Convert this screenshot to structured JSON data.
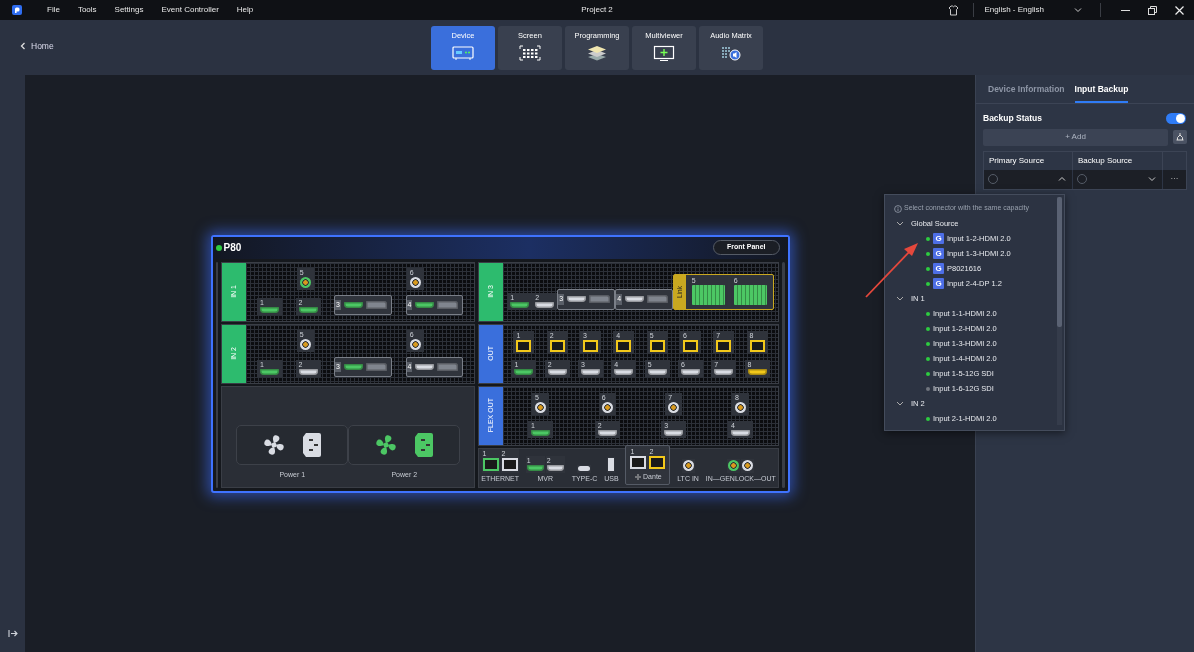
{
  "menu": [
    "File",
    "Tools",
    "Settings",
    "Event Controller",
    "Help"
  ],
  "window": {
    "title": "Project 2"
  },
  "language": {
    "value": "English - English"
  },
  "nav": {
    "back": "Home",
    "tabs": [
      {
        "label": "Device",
        "selected": true
      },
      {
        "label": "Screen",
        "selected": false
      },
      {
        "label": "Programming",
        "selected": false
      },
      {
        "label": "Multiviewer",
        "selected": false
      },
      {
        "label": "Audio Matrix",
        "selected": false
      }
    ]
  },
  "device": {
    "name": "P80",
    "online": true,
    "front_panel_button": "Front Panel",
    "left_slots": [
      {
        "label": "IN 1",
        "kind": "input",
        "top": [
          {
            "kind": "bnc",
            "number": "5",
            "color": "#4cc764"
          },
          {
            "kind": "bnc",
            "number": "6",
            "color": "#d9dce3"
          }
        ],
        "bottom": [
          {
            "kind": "hdmi",
            "number": "1",
            "color": "#4cc764"
          },
          {
            "kind": "hdmi",
            "number": "2",
            "color": "#4cc764"
          },
          {
            "kind": "module",
            "number": "3",
            "ports": [
              {
                "kind": "hdmi",
                "color": "#4cc764"
              },
              {
                "kind": "dp",
                "color": "#80858e"
              }
            ]
          },
          {
            "kind": "module",
            "number": "4",
            "ports": [
              {
                "kind": "hdmi",
                "color": "#4cc764"
              },
              {
                "kind": "dp",
                "color": "#80858e"
              }
            ]
          }
        ]
      },
      {
        "label": "IN 2",
        "kind": "input",
        "top": [
          {
            "kind": "bnc",
            "number": "5",
            "color": "#d9dce3"
          },
          {
            "kind": "bnc",
            "number": "6",
            "color": "#d9dce3"
          }
        ],
        "bottom": [
          {
            "kind": "hdmi",
            "number": "1",
            "color": "#4cc764"
          },
          {
            "kind": "hdmi",
            "number": "2",
            "color": "#d9dce3"
          },
          {
            "kind": "module",
            "number": "3",
            "ports": [
              {
                "kind": "hdmi",
                "color": "#4cc764"
              },
              {
                "kind": "dp",
                "color": "#80858e"
              }
            ]
          },
          {
            "kind": "module",
            "number": "4",
            "ports": [
              {
                "kind": "hdmi",
                "color": "#d9dce3"
              },
              {
                "kind": "dp",
                "color": "#80858e"
              }
            ]
          }
        ]
      },
      {
        "kind": "power",
        "units": [
          {
            "label": "Power 1",
            "color": "#d9dce3"
          },
          {
            "label": "Power 2",
            "color": "#4cc764"
          }
        ]
      }
    ],
    "right_slots": [
      {
        "label": "IN 3",
        "kind": "input",
        "bottom": [
          {
            "kind": "hdmi",
            "number": "1",
            "color": "#4cc764"
          },
          {
            "kind": "hdmi",
            "number": "2",
            "color": "#d9dce3"
          },
          {
            "kind": "module",
            "number": "3",
            "ports": [
              {
                "kind": "hdmi",
                "color": "#d9dce3"
              },
              {
                "kind": "dp",
                "color": "#80858e"
              }
            ]
          },
          {
            "kind": "module",
            "number": "4",
            "ports": [
              {
                "kind": "hdmi",
                "color": "#d9dce3"
              },
              {
                "kind": "dp",
                "color": "#80858e"
              }
            ]
          },
          {
            "kind": "link",
            "label": "Link",
            "ports": [
              {
                "kind": "fiber",
                "number": "5",
                "color": "#4cc764"
              },
              {
                "kind": "fiber",
                "number": "6",
                "color": "#4cc764"
              }
            ]
          }
        ]
      },
      {
        "label": "OUT",
        "kind": "output",
        "top": [
          {
            "kind": "sfp",
            "number": "1",
            "color": "#f2c81a"
          },
          {
            "kind": "sfp",
            "number": "2",
            "color": "#f2c81a"
          },
          {
            "kind": "sfp",
            "number": "3",
            "color": "#f2c81a"
          },
          {
            "kind": "sfp",
            "number": "4",
            "color": "#f2c81a"
          },
          {
            "kind": "sfp",
            "number": "5",
            "color": "#f2c81a"
          },
          {
            "kind": "sfp",
            "number": "6",
            "color": "#f2c81a"
          },
          {
            "kind": "sfp",
            "number": "7",
            "color": "#f2c81a"
          },
          {
            "kind": "sfp",
            "number": "8",
            "color": "#f2c81a"
          }
        ],
        "bottom": [
          {
            "kind": "hdmi",
            "number": "1",
            "color": "#4cc764"
          },
          {
            "kind": "hdmi",
            "number": "2",
            "color": "#d9dce3"
          },
          {
            "kind": "hdmi",
            "number": "3",
            "color": "#d9dce3"
          },
          {
            "kind": "hdmi",
            "number": "4",
            "color": "#d9dce3"
          },
          {
            "kind": "hdmi",
            "number": "5",
            "color": "#d9dce3"
          },
          {
            "kind": "hdmi",
            "number": "6",
            "color": "#d9dce3"
          },
          {
            "kind": "hdmi",
            "number": "7",
            "color": "#d9dce3"
          },
          {
            "kind": "hdmi",
            "number": "8",
            "color": "#f2c81a"
          }
        ]
      },
      {
        "label": "FLEX OUT",
        "kind": "output",
        "top": [
          {
            "kind": "bnc",
            "number": "5",
            "color": "#d9dce3"
          },
          {
            "kind": "bnc",
            "number": "6",
            "color": "#d9dce3"
          },
          {
            "kind": "bnc",
            "number": "7",
            "color": "#d9dce3"
          },
          {
            "kind": "bnc",
            "number": "8",
            "color": "#d9dce3"
          }
        ],
        "bottom": [
          {
            "kind": "hdmi",
            "number": "1",
            "color": "#4cc764"
          },
          {
            "kind": "hdmi",
            "number": "2",
            "color": "#d9dce3"
          },
          {
            "kind": "hdmi",
            "number": "3",
            "color": "#d9dce3"
          },
          {
            "kind": "hdmi",
            "number": "4",
            "color": "#d9dce3"
          }
        ]
      },
      {
        "kind": "io",
        "groups": [
          {
            "label": "ETHERNET",
            "ports": [
              {
                "kind": "rj45",
                "number": "1",
                "color": "#4cc764"
              },
              {
                "kind": "rj45",
                "number": "2",
                "color": "#d9dce3"
              }
            ]
          },
          {
            "label": "MVR",
            "ports": [
              {
                "kind": "hdmi",
                "number": "1",
                "color": "#4cc764"
              },
              {
                "kind": "hdmi",
                "number": "2",
                "color": "#d9dce3"
              }
            ]
          },
          {
            "label": "TYPE-C",
            "ports": [
              {
                "kind": "usbc",
                "color": "#d9dce3"
              }
            ]
          },
          {
            "label": "USB",
            "ports": [
              {
                "kind": "usb",
                "color": "#d9dce3"
              }
            ]
          },
          {
            "label": "Dante",
            "boxed": true,
            "ports": [
              {
                "kind": "rj45",
                "number": "1",
                "color": "#d9dce3"
              },
              {
                "kind": "rj45",
                "number": "2",
                "color": "#f2c81a"
              }
            ]
          },
          {
            "label": "LTC IN",
            "ports": [
              {
                "kind": "bnc",
                "color": "#d9dce3"
              }
            ]
          },
          {
            "label": "IN—GENLOCK—OUT",
            "ports": [
              {
                "kind": "bnc",
                "color": "#4cc764"
              },
              {
                "kind": "bnc",
                "color": "#d9dce3"
              }
            ]
          }
        ]
      }
    ]
  },
  "side_panel": {
    "tabs": [
      {
        "label": "Device Information",
        "selected": false
      },
      {
        "label": "Input Backup",
        "selected": true
      }
    ],
    "backup_status": {
      "label": "Backup Status",
      "on": true
    },
    "add_button": "+ Add",
    "columns": [
      "Primary Source",
      "Backup Source"
    ],
    "rows": [
      {
        "primary": {
          "selected": false,
          "expanded": true
        },
        "backup": {
          "selected": false,
          "expanded": false
        },
        "more": "···"
      }
    ]
  },
  "source_dropdown": {
    "hint": "Select connector with the same capacity",
    "groups": [
      {
        "label": "Global Source",
        "expanded": true,
        "items": [
          {
            "label": "Input 1-2-HDMI 2.0",
            "online": true,
            "badge": "G"
          },
          {
            "label": "Input 1-3-HDMI 2.0",
            "online": true,
            "badge": "G"
          },
          {
            "label": "P8021616",
            "online": true,
            "badge": "G"
          },
          {
            "label": "Input 2-4-DP 1.2",
            "online": true,
            "badge": "G"
          }
        ]
      },
      {
        "label": "IN 1",
        "expanded": true,
        "items": [
          {
            "label": "Input 1-1-HDMI 2.0",
            "online": true
          },
          {
            "label": "Input 1-2-HDMI 2.0",
            "online": true
          },
          {
            "label": "Input 1-3-HDMI 2.0",
            "online": true
          },
          {
            "label": "Input 1-4-HDMI 2.0",
            "online": true
          },
          {
            "label": "Input 1-5-12G SDI",
            "online": true
          },
          {
            "label": "Input 1-6-12G SDI",
            "online": false
          }
        ]
      },
      {
        "label": "IN 2",
        "expanded": true,
        "items": [
          {
            "label": "Input 2-1-HDMI 2.0",
            "online": true
          }
        ]
      }
    ]
  }
}
